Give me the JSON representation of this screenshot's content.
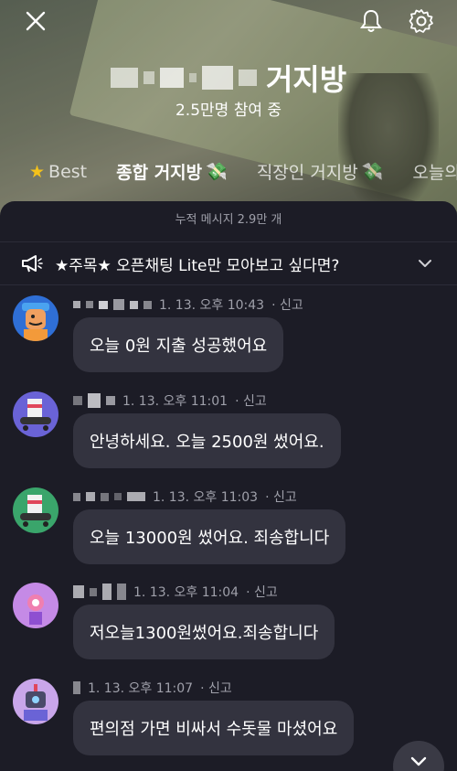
{
  "header": {
    "title": "거지방",
    "participants": "2.5만명 참여 중"
  },
  "tabs": [
    {
      "label": "Best",
      "icon": "star-icon"
    },
    {
      "label": "종합 거지방",
      "icon": "money-icon"
    },
    {
      "label": "직장인 거지방",
      "icon": "money-icon"
    },
    {
      "label": "오늘의"
    }
  ],
  "panel": {
    "cumulative": "누적 메시지 2.9만 개",
    "notice": "★주목★ 오픈채팅 Lite만 모아보고 싶다면?"
  },
  "messages": [
    {
      "time": "1. 13. 오후 10:43",
      "report": "· 신고",
      "text": "오늘 0원 지출 성공했어요",
      "avatar": "avatar-blue-hat"
    },
    {
      "time": "1. 13. 오후 11:01",
      "report": "· 신고",
      "text": "안녕하세요. 오늘 2500원 썼어요.",
      "avatar": "avatar-skate-purple"
    },
    {
      "time": "1. 13. 오후 11:03",
      "report": "· 신고",
      "text": "오늘 13000원 썼어요. 죄송합니다",
      "avatar": "avatar-skate-green"
    },
    {
      "time": "1. 13. 오후 11:04",
      "report": "· 신고",
      "text": "저오늘1300원썼어요.죄송합니다",
      "avatar": "avatar-flower-purple"
    },
    {
      "time": "1. 13. 오후 11:07",
      "report": "· 신고",
      "text": "편의점  가면 비싸서 수돗물 마셨어요",
      "avatar": "avatar-robot-lilac"
    }
  ],
  "colors": {
    "panel_bg": "#1c1c26",
    "bubble_bg": "#33333f",
    "meta_text": "#9fa0aa",
    "star": "#f4c21b"
  }
}
